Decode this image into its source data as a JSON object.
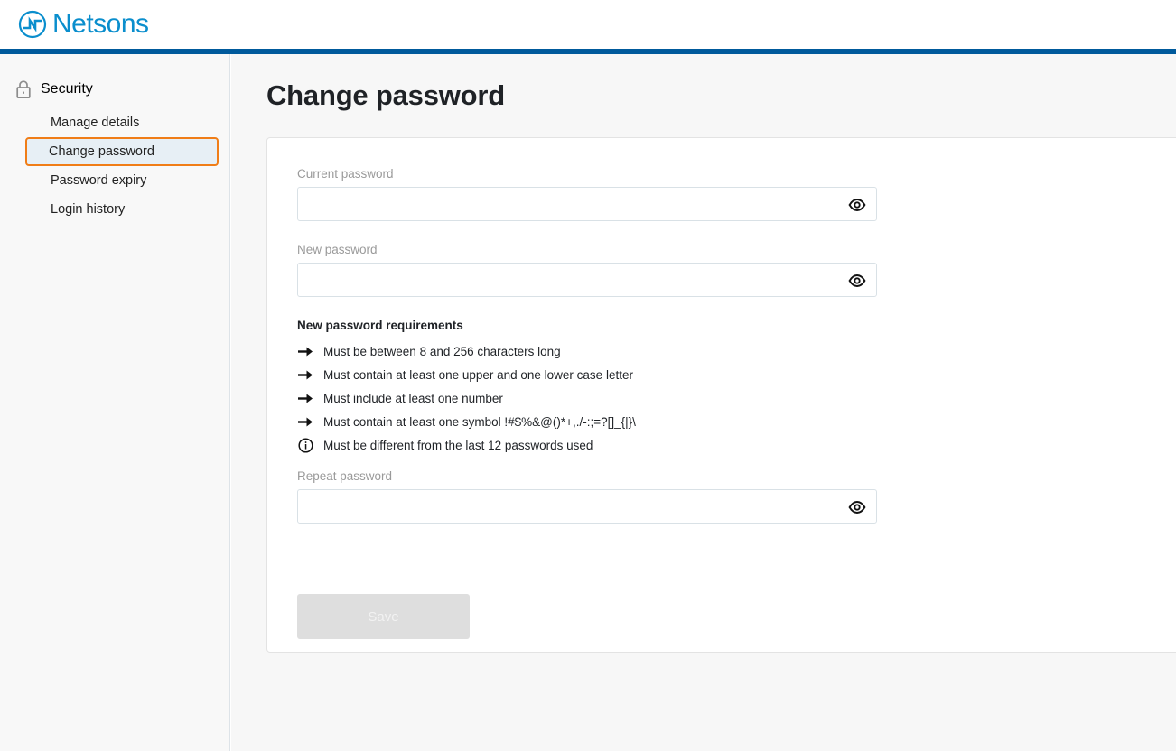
{
  "brand": {
    "name": "Netsons",
    "logo_icon": "netsons-circle-wave-logo",
    "color": "#0a8ecd",
    "band_color": "#005a9c"
  },
  "sidebar": {
    "section_icon": "lock-icon",
    "section_title": "Security",
    "items": [
      {
        "label": "Manage details",
        "selected": false
      },
      {
        "label": "Change password",
        "selected": true
      },
      {
        "label": "Password expiry",
        "selected": false
      },
      {
        "label": "Login history",
        "selected": false
      }
    ],
    "selected_border_color": "#f07d17",
    "selected_background_color": "#e7eff5"
  },
  "main": {
    "page_title": "Change password",
    "fields": {
      "current": {
        "label": "Current password",
        "value": "",
        "placeholder": "",
        "toggle_icon": "eye-icon"
      },
      "new": {
        "label": "New password",
        "value": "",
        "placeholder": "",
        "toggle_icon": "eye-icon"
      },
      "repeat": {
        "label": "Repeat password",
        "value": "",
        "placeholder": "",
        "toggle_icon": "eye-icon"
      }
    },
    "requirements": {
      "title": "New password requirements",
      "items": [
        {
          "icon": "arrow-right-icon",
          "text": "Must be between 8 and 256 characters long"
        },
        {
          "icon": "arrow-right-icon",
          "text": "Must contain at least one upper and one lower case letter"
        },
        {
          "icon": "arrow-right-icon",
          "text": "Must include at least one number"
        },
        {
          "icon": "arrow-right-icon",
          "text": "Must contain at least one symbol !#$%&@()*+,./-:;=?[]_{|}\\"
        },
        {
          "icon": "info-icon",
          "text": "Must be different from the last 12 passwords used"
        }
      ]
    },
    "save_label": "Save",
    "save_disabled": true
  }
}
